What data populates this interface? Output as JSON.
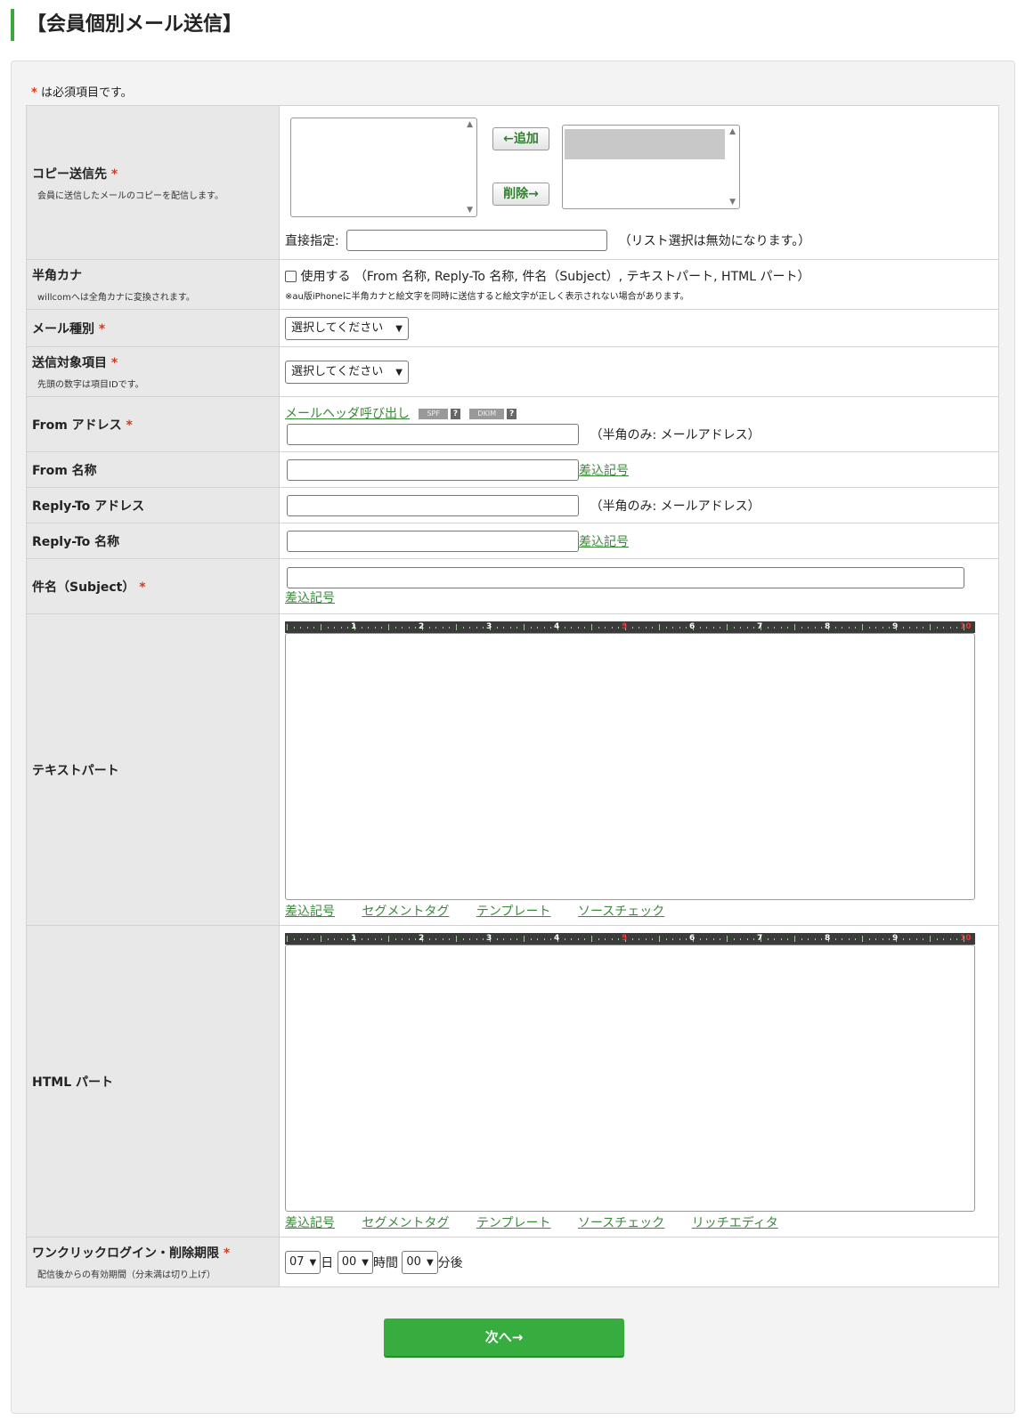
{
  "page": {
    "title": "【会員個別メール送信】"
  },
  "form": {
    "required_note": "は必須項目です。",
    "required_mark": "*",
    "copy": {
      "label": "コピー送信先",
      "desc": "会員に送信したメールのコピーを配信します。",
      "add_button": "←追加",
      "remove_button": "削除→",
      "direct_label": "直接指定:",
      "direct_hint": "（リスト選択は無効になります。）"
    },
    "hankaku": {
      "label": "半角カナ",
      "desc": "willcomへは全角カナに変換されます。",
      "checkbox_label": "使用する （From 名称, Reply-To 名称, 件名（Subject）, テキストパート, HTML パート）",
      "note": "※au版iPhoneに半角カナと絵文字を同時に送信すると絵文字が正しく表示されない場合があります。"
    },
    "mail_type": {
      "label": "メール種別",
      "selected": "選択してください"
    },
    "target_field": {
      "label": "送信対象項目",
      "desc": "先頭の数字は項目IDです。",
      "selected": "選択してください"
    },
    "from_address": {
      "label": "From アドレス",
      "header_link": "メールヘッダ呼び出し",
      "spf": "SPF",
      "dkim": "DKIM",
      "q": "?",
      "hint": "（半角のみ: メールアドレス）"
    },
    "from_name": {
      "label": "From 名称",
      "insert_link": "差込記号"
    },
    "reply_to_address": {
      "label": "Reply-To アドレス",
      "hint": "（半角のみ: メールアドレス）"
    },
    "reply_to_name": {
      "label": "Reply-To 名称",
      "insert_link": "差込記号"
    },
    "subject": {
      "label": "件名（Subject）",
      "insert_link": "差込記号"
    },
    "ruler_numbers": [
      "1",
      "2",
      "3",
      "4",
      "5",
      "6",
      "7",
      "8",
      "9",
      "10"
    ],
    "text_part": {
      "label": "テキストパート",
      "links": [
        "差込記号",
        "セグメントタグ",
        "テンプレート",
        "ソースチェック"
      ]
    },
    "html_part": {
      "label": "HTML パート",
      "links": [
        "差込記号",
        "セグメントタグ",
        "テンプレート",
        "ソースチェック",
        "リッチエディタ"
      ]
    },
    "expiry": {
      "label": "ワンクリックログイン・削除期限",
      "desc": "配信後からの有効期間（分未満は切り上げ）",
      "days": "07",
      "days_unit": "日",
      "hours": "00",
      "hours_unit": "時間",
      "minutes": "00",
      "minutes_unit": "分後"
    }
  },
  "next_button": "次へ→",
  "colors": {
    "accent": "#36ad3e",
    "link": "#3a8a3a",
    "required": "#d9381e",
    "label_bg": "#e8e8e8"
  }
}
